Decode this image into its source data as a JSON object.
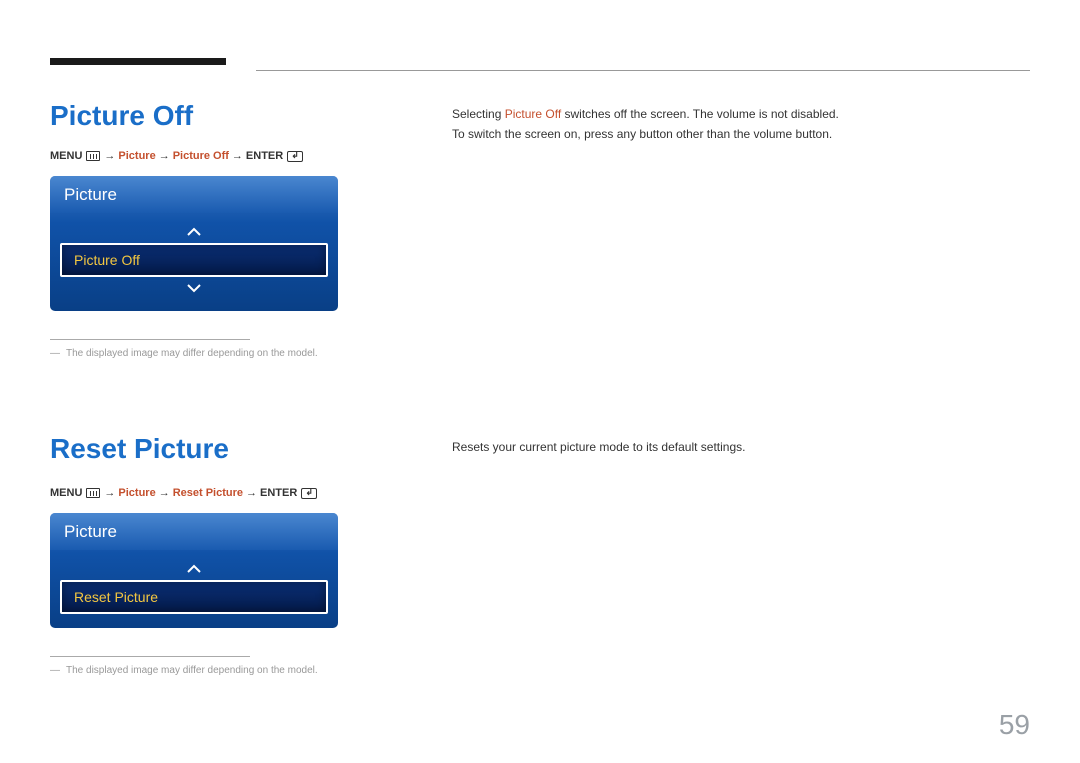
{
  "pageNumber": "59",
  "section1": {
    "title": "Picture Off",
    "path": {
      "menu": "MENU",
      "steps": [
        "Picture",
        "Picture Off"
      ],
      "enter": "ENTER"
    },
    "osd": {
      "header": "Picture",
      "selected": "Picture Off"
    },
    "footnote": "The displayed image may differ depending on the model.",
    "description": {
      "line1_pre": "Selecting ",
      "line1_hl": "Picture Off",
      "line1_post": " switches off the screen. The volume is not disabled.",
      "line2": "To switch the screen on, press any button other than the volume button."
    }
  },
  "section2": {
    "title": "Reset Picture",
    "path": {
      "menu": "MENU",
      "steps": [
        "Picture",
        "Reset Picture"
      ],
      "enter": "ENTER"
    },
    "osd": {
      "header": "Picture",
      "selected": "Reset Picture"
    },
    "footnote": "The displayed image may differ depending on the model.",
    "description": {
      "line1": "Resets your current picture mode to its default settings."
    }
  }
}
